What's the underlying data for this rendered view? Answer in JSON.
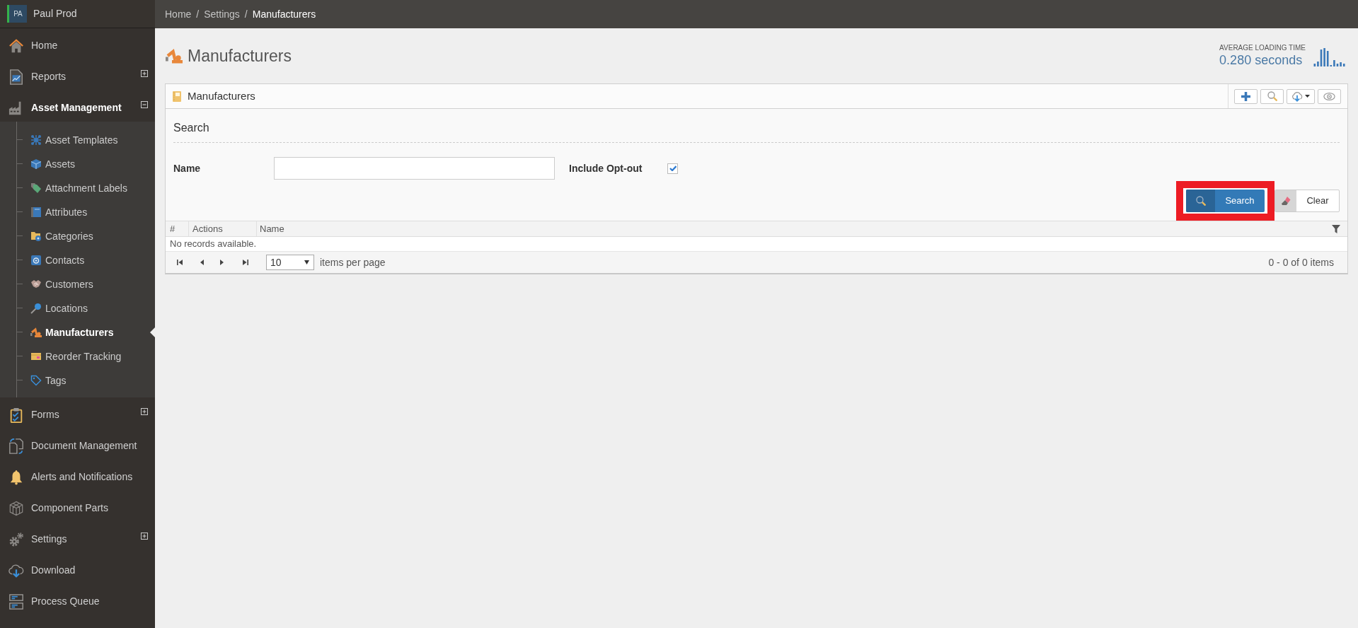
{
  "sidebar": {
    "profile": {
      "initials": "PA",
      "name": "Paul Prod"
    },
    "items": [
      {
        "kind": "link",
        "label": "Home",
        "selected": false
      },
      {
        "kind": "group",
        "label": "Reports",
        "selected": false,
        "expanded": false
      },
      {
        "kind": "group",
        "label": "Asset Management",
        "selected": true,
        "expanded": true,
        "children": [
          {
            "label": "Asset Templates",
            "selected": false
          },
          {
            "label": "Assets",
            "selected": false
          },
          {
            "label": "Attachment Labels",
            "selected": false
          },
          {
            "label": "Attributes",
            "selected": false
          },
          {
            "label": "Categories",
            "selected": false
          },
          {
            "label": "Contacts",
            "selected": false
          },
          {
            "label": "Customers",
            "selected": false
          },
          {
            "label": "Locations",
            "selected": false
          },
          {
            "label": "Manufacturers",
            "selected": true
          },
          {
            "label": "Reorder Tracking",
            "selected": false
          },
          {
            "label": "Tags",
            "selected": false
          }
        ]
      },
      {
        "kind": "group",
        "label": "Forms",
        "selected": false,
        "expanded": false
      },
      {
        "kind": "link",
        "label": "Document Management",
        "selected": false
      },
      {
        "kind": "link",
        "label": "Alerts and Notifications",
        "selected": false
      },
      {
        "kind": "link",
        "label": "Component Parts",
        "selected": false
      },
      {
        "kind": "group",
        "label": "Settings",
        "selected": false,
        "expanded": false
      },
      {
        "kind": "link",
        "label": "Download",
        "selected": false
      },
      {
        "kind": "link",
        "label": "Process Queue",
        "selected": false
      }
    ]
  },
  "breadcrumb": [
    {
      "label": "Home",
      "separator": "/",
      "current": false
    },
    {
      "label": "Settings",
      "separator": "/",
      "current": false
    },
    {
      "label": "Manufacturers",
      "current": true
    }
  ],
  "page": {
    "title": "Manufacturers",
    "loading_time": {
      "label": "AVERAGE LOADING TIME",
      "value": "0.280 seconds"
    }
  },
  "panel": {
    "title": "Manufacturers",
    "search": {
      "heading": "Search",
      "fields": [
        {
          "kind": "text",
          "label": "Name"
        },
        {
          "kind": "checkbox",
          "label": "Include Opt-out",
          "checked": true
        }
      ],
      "buttons": [
        {
          "kind": "primary",
          "label": "Search",
          "highlighted": true
        },
        {
          "kind": "secondary",
          "label": "Clear",
          "highlighted": false
        }
      ]
    },
    "table": {
      "columns": [
        {
          "label": "#"
        },
        {
          "label": "Actions"
        },
        {
          "label": "Name"
        }
      ],
      "empty_message": "No records available."
    },
    "pager": {
      "page_size": "10",
      "page_size_label": "items per page",
      "summary": "0 - 0 of 0 items"
    }
  }
}
